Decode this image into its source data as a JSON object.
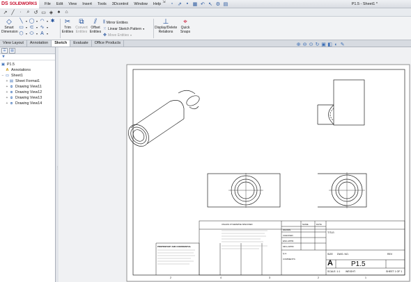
{
  "app": {
    "logo_ds": "DS",
    "logo_text": "SOLIDWORKS",
    "document_title": "P1.5 - Sheet1 *"
  },
  "menu": [
    {
      "label": "File"
    },
    {
      "label": "Edit"
    },
    {
      "label": "View"
    },
    {
      "label": "Insert"
    },
    {
      "label": "Tools"
    },
    {
      "label": "3Dcontrol"
    },
    {
      "label": "Window"
    },
    {
      "label": "Help"
    }
  ],
  "command_manager": {
    "smart_dimension": "Smart\nDimension",
    "trim_entities": "Trim\nEntities",
    "convert_entities": "Convert\nEntities",
    "offset_entities": "Offset\nEntities",
    "mirror_entities": "Mirror Entities",
    "linear_sketch_pattern": "Linear Sketch Pattern",
    "move_entities": "Move Entities",
    "display_delete_relations": "Display/Delete\nRelations",
    "quick_snaps": "Quick\nSnaps"
  },
  "tabs": [
    {
      "label": "View Layout",
      "active": false
    },
    {
      "label": "Annotation",
      "active": false
    },
    {
      "label": "Sketch",
      "active": true
    },
    {
      "label": "Evaluate",
      "active": false
    },
    {
      "label": "Office Products",
      "active": false
    }
  ],
  "feature_tree": {
    "root": "P1.5",
    "items": [
      {
        "label": "Annotations",
        "icon": "annotations-icon",
        "expander": ""
      },
      {
        "label": "Sheet1",
        "icon": "sheet-icon",
        "expander": "−"
      },
      {
        "label": "Sheet Format1",
        "icon": "sheet-format-icon",
        "expander": "+"
      },
      {
        "label": "Drawing View11",
        "icon": "drawing-view-icon",
        "expander": "+"
      },
      {
        "label": "Drawing View12",
        "icon": "drawing-view-icon",
        "expander": "+"
      },
      {
        "label": "Drawing View13",
        "icon": "drawing-view-icon",
        "expander": "+"
      },
      {
        "label": "Drawing View14",
        "icon": "drawing-view-icon",
        "expander": "+"
      }
    ]
  },
  "title_block": {
    "name": "NAME",
    "date": "DATE",
    "drawn": "DRAWN",
    "checked": "CHECKED",
    "eng_appr": "ENG APPR.",
    "mfg_appr": "MFG APPR.",
    "qa": "Q.A.",
    "comments": "COMMENTS:",
    "title": "TITLE:",
    "size_label": "SIZE",
    "size_value": "A",
    "dwg_no_label": "DWG. NO.",
    "dwg_no_value": "P1.5",
    "rev_label": "REV",
    "scale": "SCALE: 1:1",
    "weight": "WEIGHT:",
    "sheet": "SHEET 1 OF 1",
    "proprietary": "PROPRIETARY AND CONFIDENTIAL",
    "unless_noted": "UNLESS OTHERWISE SPECIFIED:",
    "zone_numbers": [
      "2",
      "4",
      "3",
      "2",
      "1"
    ]
  },
  "colors": {
    "accent": "#1f4f9a",
    "brand": "#c8102e"
  }
}
